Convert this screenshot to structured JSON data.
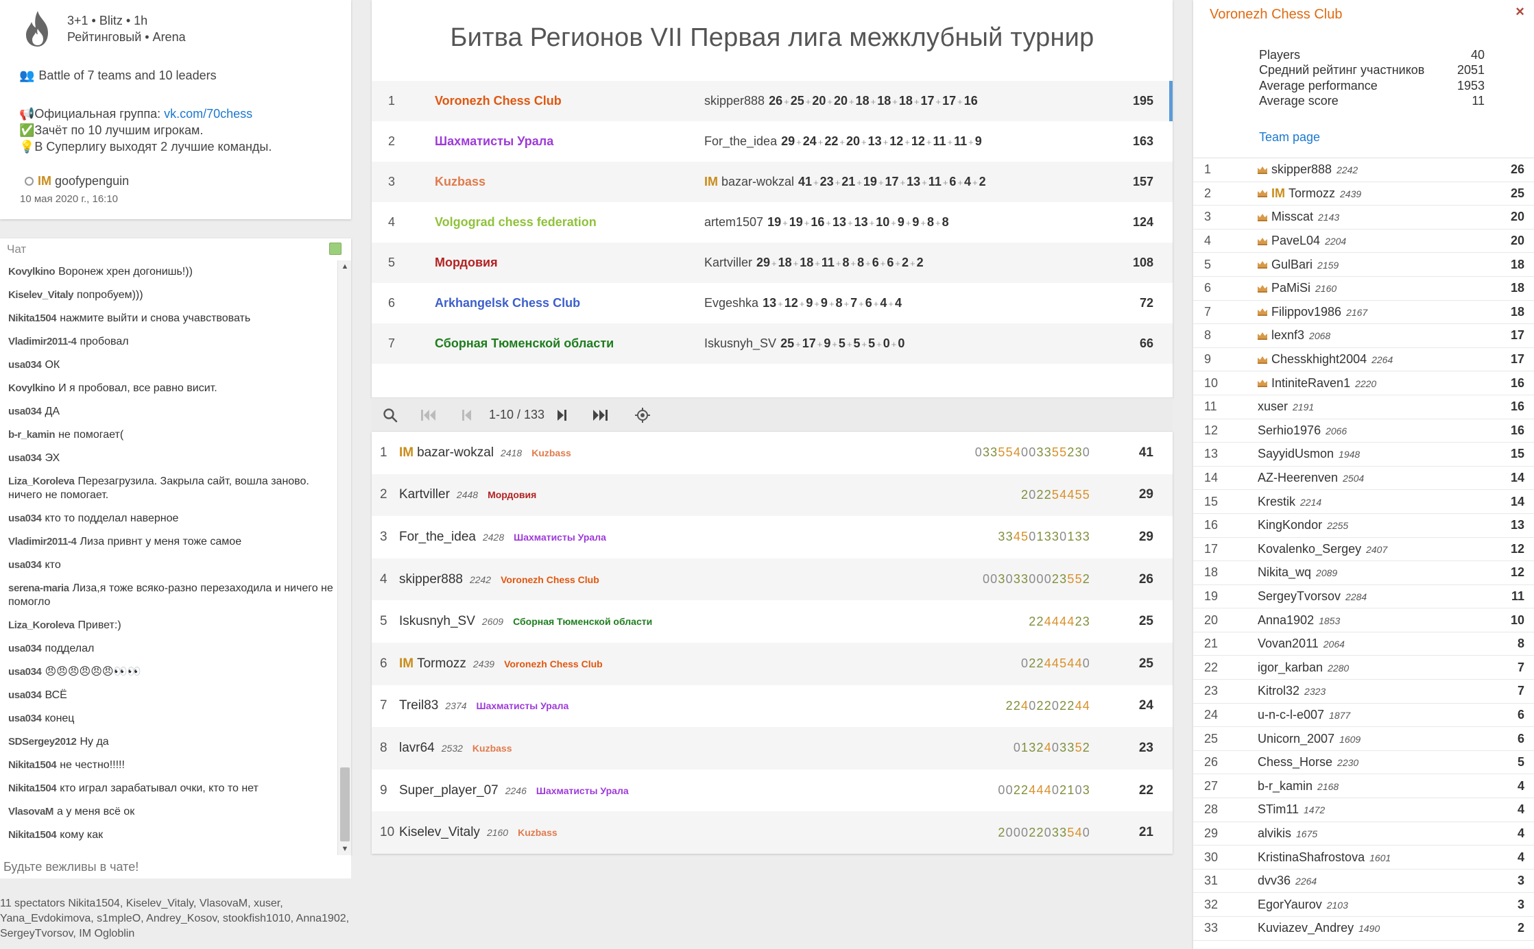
{
  "info": {
    "clock": "3+1 • Blitz • 1h",
    "mode": "Рейтинговый • Arena",
    "teams_line": "Battle of 7 teams and 10 leaders",
    "group_prefix": "Официальная группа: ",
    "group_link": "vk.com/70chess",
    "desc1": "Зачёт по 10 лучшим игрокам.",
    "desc2": "В Суперлигу выходят 2 лучшие команды.",
    "creator_title": "IM",
    "creator_name": "goofypenguin",
    "date": "10 мая 2020 г., 16:10"
  },
  "chat": {
    "header": "Чат",
    "placeholder": "Будьте вежливы в чате!",
    "messages": [
      {
        "user": "Kovylkino",
        "text": "Воронеж хрен догонишь!))"
      },
      {
        "user": "Kiselev_Vitaly",
        "text": "попробуем)))"
      },
      {
        "user": "Nikita1504",
        "text": "нажмите выйти и снова учавствовать"
      },
      {
        "user": "Vladimir2011-4",
        "text": "пробовал"
      },
      {
        "user": "usa034",
        "text": "ОК"
      },
      {
        "user": "Kovylkino",
        "text": "И я пробовал, все равно висит."
      },
      {
        "user": "usa034",
        "text": "ДА"
      },
      {
        "user": "b-r_kamin",
        "text": "не помогает("
      },
      {
        "user": "usa034",
        "text": "ЭХ"
      },
      {
        "user": "Liza_Koroleva",
        "text": "Перезагрузила. Закрыла сайт, вошла заново. ничего не помогает."
      },
      {
        "user": "usa034",
        "text": "кто то подделал наверное"
      },
      {
        "user": "Vladimir2011-4",
        "text": "Лиза привнт у меня тоже самое"
      },
      {
        "user": "usa034",
        "text": "кто"
      },
      {
        "user": "serena-maria",
        "text": "Лиза,я тоже всяко-разно перезаходила и ничего не помогло"
      },
      {
        "user": "Liza_Koroleva",
        "text": "Привет:)"
      },
      {
        "user": "usa034",
        "text": "подделал"
      },
      {
        "user": "usa034",
        "text": "😠😠😠😠😠😠👀👀"
      },
      {
        "user": "usa034",
        "text": "ВСЁ"
      },
      {
        "user": "usa034",
        "text": "конец"
      },
      {
        "user": "SDSergey2012",
        "text": "Ну да"
      },
      {
        "user": "Nikita1504",
        "text": "не честно!!!!!"
      },
      {
        "user": "Nikita1504",
        "text": "кто играл зарабатывал очки, кто то нет"
      },
      {
        "user": "VlasovaM",
        "text": "а у меня всё ок"
      },
      {
        "user": "Nikita1504",
        "text": "кому как"
      }
    ]
  },
  "spectators": "11 spectators Nikita1504, Kiselev_Vitaly, VlasovaM, xuser, Yana_Evdokimova, s1mpleO, Andrey_Kosov, stookfish1010, Anna1902, SergeyTvorsov, IM Ogloblin",
  "tournament": {
    "title": "Битва Регионов VII Первая лига межклубный турнир",
    "teams": [
      {
        "rank": "1",
        "name": "Voronezh Chess Club",
        "color": "#e0570f",
        "leader_title": "",
        "leader": "skipper888",
        "scores": [
          "26",
          "25",
          "20",
          "20",
          "18",
          "18",
          "18",
          "17",
          "17",
          "16"
        ],
        "total": "195"
      },
      {
        "rank": "2",
        "name": "Шахматисты Урала",
        "color": "#9d3ad8",
        "leader_title": "",
        "leader": "For_the_idea",
        "scores": [
          "29",
          "24",
          "22",
          "20",
          "13",
          "12",
          "12",
          "11",
          "11",
          "9"
        ],
        "total": "163"
      },
      {
        "rank": "3",
        "name": "Kuzbass",
        "color": "#e07b4d",
        "leader_title": "IM",
        "leader": "bazar-wokzal",
        "scores": [
          "41",
          "23",
          "21",
          "19",
          "17",
          "13",
          "11",
          "6",
          "4",
          "2"
        ],
        "total": "157"
      },
      {
        "rank": "4",
        "name": "Volgograd chess federation",
        "color": "#8fc23b",
        "leader_title": "",
        "leader": "artem1507",
        "scores": [
          "19",
          "19",
          "16",
          "13",
          "13",
          "10",
          "9",
          "9",
          "8",
          "8"
        ],
        "total": "124"
      },
      {
        "rank": "5",
        "name": "Мордовия",
        "color": "#b32222",
        "leader_title": "",
        "leader": "Kartviller",
        "scores": [
          "29",
          "18",
          "18",
          "11",
          "8",
          "8",
          "6",
          "6",
          "2",
          "2"
        ],
        "total": "108"
      },
      {
        "rank": "6",
        "name": "Arkhangelsk Chess Club",
        "color": "#3d5fcc",
        "leader_title": "",
        "leader": "Evgeshka",
        "scores": [
          "13",
          "12",
          "9",
          "9",
          "8",
          "7",
          "6",
          "4",
          "4"
        ],
        "total": "72"
      },
      {
        "rank": "7",
        "name": "Сборная Тюменской области",
        "color": "#1e7d1e",
        "leader_title": "",
        "leader": "Iskusnyh_SV",
        "scores": [
          "25",
          "17",
          "9",
          "5",
          "5",
          "5",
          "0",
          "0"
        ],
        "total": "66"
      }
    ],
    "pager": "1-10 / 133",
    "players": [
      {
        "rank": "1",
        "title": "IM",
        "name": "bazar-wokzal",
        "rating": "2418",
        "team": "Kuzbass",
        "team_color": "#e07b4d",
        "sheet": "033554003355230",
        "score": "41"
      },
      {
        "rank": "2",
        "title": "",
        "name": "Kartviller",
        "rating": "2448",
        "team": "Мордовия",
        "team_color": "#b32222",
        "sheet": "202254455",
        "score": "29"
      },
      {
        "rank": "3",
        "title": "",
        "name": "For_the_idea",
        "rating": "2428",
        "team": "Шахматисты Урала",
        "team_color": "#9d3ad8",
        "sheet": "334501330133",
        "score": "29"
      },
      {
        "rank": "4",
        "title": "",
        "name": "skipper888",
        "rating": "2242",
        "team": "Voronezh Chess Club",
        "team_color": "#e0570f",
        "sheet": "00303300023552",
        "score": "26"
      },
      {
        "rank": "5",
        "title": "",
        "name": "Iskusnyh_SV",
        "rating": "2609",
        "team": "Сборная Тюменской области",
        "team_color": "#1e7d1e",
        "sheet": "22444423",
        "score": "25"
      },
      {
        "rank": "6",
        "title": "IM",
        "name": "Tormozz",
        "rating": "2439",
        "team": "Voronezh Chess Club",
        "team_color": "#e0570f",
        "sheet": "022445440",
        "score": "25"
      },
      {
        "rank": "7",
        "title": "",
        "name": "Treil83",
        "rating": "2374",
        "team": "Шахматисты Урала",
        "team_color": "#9d3ad8",
        "sheet": "22402202244",
        "score": "24"
      },
      {
        "rank": "8",
        "title": "",
        "name": "lavr64",
        "rating": "2532",
        "team": "Kuzbass",
        "team_color": "#e07b4d",
        "sheet": "0132403352",
        "score": "23"
      },
      {
        "rank": "9",
        "title": "",
        "name": "Super_player_07",
        "rating": "2246",
        "team": "Шахматисты Урала",
        "team_color": "#9d3ad8",
        "sheet": "002244402103",
        "score": "22"
      },
      {
        "rank": "10",
        "title": "",
        "name": "Kiselev_Vitaly",
        "rating": "2160",
        "team": "Kuzbass",
        "team_color": "#e07b4d",
        "sheet": "200022033540",
        "score": "21"
      }
    ]
  },
  "team_panel": {
    "title": "Voronezh Chess Club",
    "close": "×",
    "stats": [
      {
        "label": "Players",
        "value": "40"
      },
      {
        "label": "Средний рейтинг участников",
        "value": "2051"
      },
      {
        "label": "Average performance",
        "value": "1953"
      },
      {
        "label": "Average score",
        "value": "11"
      }
    ],
    "team_page": "Team page",
    "members": [
      {
        "rank": "1",
        "leader": true,
        "title": "",
        "name": "skipper888",
        "rating": "2242",
        "score": "26"
      },
      {
        "rank": "2",
        "leader": true,
        "title": "IM",
        "name": "Tormozz",
        "rating": "2439",
        "score": "25"
      },
      {
        "rank": "3",
        "leader": true,
        "title": "",
        "name": "Misscat",
        "rating": "2143",
        "score": "20"
      },
      {
        "rank": "4",
        "leader": true,
        "title": "",
        "name": "PaveL04",
        "rating": "2204",
        "score": "20"
      },
      {
        "rank": "5",
        "leader": true,
        "title": "",
        "name": "GulBari",
        "rating": "2159",
        "score": "18"
      },
      {
        "rank": "6",
        "leader": true,
        "title": "",
        "name": "PaMiSi",
        "rating": "2160",
        "score": "18"
      },
      {
        "rank": "7",
        "leader": true,
        "title": "",
        "name": "Filippov1986",
        "rating": "2167",
        "score": "18"
      },
      {
        "rank": "8",
        "leader": true,
        "title": "",
        "name": "lexnf3",
        "rating": "2068",
        "score": "17"
      },
      {
        "rank": "9",
        "leader": true,
        "title": "",
        "name": "Chesskhight2004",
        "rating": "2264",
        "score": "17"
      },
      {
        "rank": "10",
        "leader": true,
        "title": "",
        "name": "IntiniteRaven1",
        "rating": "2220",
        "score": "16"
      },
      {
        "rank": "11",
        "leader": false,
        "title": "",
        "name": "xuser",
        "rating": "2191",
        "score": "16"
      },
      {
        "rank": "12",
        "leader": false,
        "title": "",
        "name": "Serhio1976",
        "rating": "2066",
        "score": "16"
      },
      {
        "rank": "13",
        "leader": false,
        "title": "",
        "name": "SayyidUsmon",
        "rating": "1948",
        "score": "15"
      },
      {
        "rank": "14",
        "leader": false,
        "title": "",
        "name": "AZ-Heerenven",
        "rating": "2504",
        "score": "14"
      },
      {
        "rank": "15",
        "leader": false,
        "title": "",
        "name": "Krestik",
        "rating": "2214",
        "score": "14"
      },
      {
        "rank": "16",
        "leader": false,
        "title": "",
        "name": "KingKondor",
        "rating": "2255",
        "score": "13"
      },
      {
        "rank": "17",
        "leader": false,
        "title": "",
        "name": "Kovalenko_Sergey",
        "rating": "2407",
        "score": "12"
      },
      {
        "rank": "18",
        "leader": false,
        "title": "",
        "name": "Nikita_wq",
        "rating": "2089",
        "score": "12"
      },
      {
        "rank": "19",
        "leader": false,
        "title": "",
        "name": "SergeyTvorsov",
        "rating": "2284",
        "score": "11"
      },
      {
        "rank": "20",
        "leader": false,
        "title": "",
        "name": "Anna1902",
        "rating": "1853",
        "score": "10"
      },
      {
        "rank": "21",
        "leader": false,
        "title": "",
        "name": "Vovan2011",
        "rating": "2064",
        "score": "8"
      },
      {
        "rank": "22",
        "leader": false,
        "title": "",
        "name": "igor_karban",
        "rating": "2280",
        "score": "7"
      },
      {
        "rank": "23",
        "leader": false,
        "title": "",
        "name": "Kitrol32",
        "rating": "2323",
        "score": "7"
      },
      {
        "rank": "24",
        "leader": false,
        "title": "",
        "name": "u-n-c-l-e007",
        "rating": "1877",
        "score": "6"
      },
      {
        "rank": "25",
        "leader": false,
        "title": "",
        "name": "Unicorn_2007",
        "rating": "1609",
        "score": "6"
      },
      {
        "rank": "26",
        "leader": false,
        "title": "",
        "name": "Chess_Horse",
        "rating": "2230",
        "score": "5"
      },
      {
        "rank": "27",
        "leader": false,
        "title": "",
        "name": "b-r_kamin",
        "rating": "2168",
        "score": "4"
      },
      {
        "rank": "28",
        "leader": false,
        "title": "",
        "name": "STim11",
        "rating": "1472",
        "score": "4"
      },
      {
        "rank": "29",
        "leader": false,
        "title": "",
        "name": "alvikis",
        "rating": "1675",
        "score": "4"
      },
      {
        "rank": "30",
        "leader": false,
        "title": "",
        "name": "KristinaShafrostova",
        "rating": "1601",
        "score": "4"
      },
      {
        "rank": "31",
        "leader": false,
        "title": "",
        "name": "dvv36",
        "rating": "2264",
        "score": "3"
      },
      {
        "rank": "32",
        "leader": false,
        "title": "",
        "name": "EgorYaurov",
        "rating": "2103",
        "score": "3"
      },
      {
        "rank": "33",
        "leader": false,
        "title": "",
        "name": "Kuviazev_Andrey",
        "rating": "1490",
        "score": "2"
      }
    ]
  }
}
